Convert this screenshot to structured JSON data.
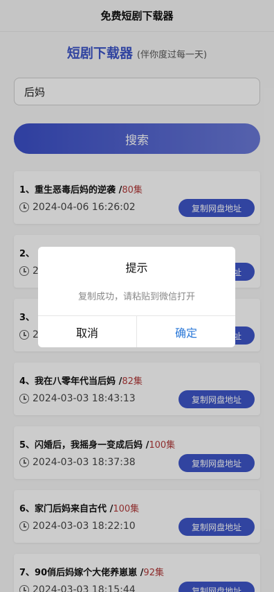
{
  "topbar": {
    "title": "免费短剧下载器"
  },
  "brand": {
    "name": "短剧下载器",
    "subtitle": "(伴你度过每一天)"
  },
  "search": {
    "value": "后妈",
    "button_label": "搜索"
  },
  "results": [
    {
      "title": "1、重生恶毒后妈的逆袭 /",
      "episodes": "80集",
      "time": "2024-04-06 16:26:02",
      "copy_label": "复制网盘地址"
    },
    {
      "title": "2、",
      "episodes": "",
      "time": "2",
      "copy_label": "复制网盘地址"
    },
    {
      "title": "3、",
      "episodes": "",
      "time": "2",
      "copy_label": "复制网盘地址"
    },
    {
      "title": "4、我在八零年代当后妈 /",
      "episodes": "82集",
      "time": "2024-03-03 18:43:13",
      "copy_label": "复制网盘地址"
    },
    {
      "title": "5、闪婚后，我摇身一变成后妈 /",
      "episodes": "100集",
      "time": "2024-03-03 18:37:38",
      "copy_label": "复制网盘地址"
    },
    {
      "title": "6、家门后妈来自古代 /",
      "episodes": "100集",
      "time": "2024-03-03 18:22:10",
      "copy_label": "复制网盘地址"
    },
    {
      "title": "7、90俏后妈嫁个大佬养崽崽 /",
      "episodes": "92集",
      "time": "2024-03-03 18:15:44",
      "copy_label": "复制网盘地址"
    }
  ],
  "modal": {
    "title": "提示",
    "message": "复制成功，请粘贴到微信打开",
    "cancel_label": "取消",
    "ok_label": "确定"
  },
  "colors": {
    "accent": "#3e56c8",
    "episode": "#b23a3a",
    "confirm": "#2b78d8"
  }
}
